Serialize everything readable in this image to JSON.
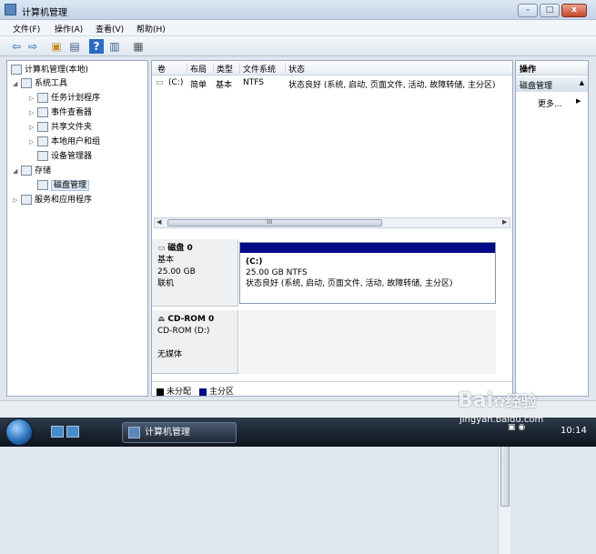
{
  "window": {
    "title": "计算机管理",
    "min_label": "–",
    "max_label": "□",
    "close_label": "x"
  },
  "menu": [
    "文件(F)",
    "操作(A)",
    "查看(V)",
    "帮助(H)"
  ],
  "toolbar": [
    {
      "icon": "back-arrow-icon",
      "glyph": "⇦"
    },
    {
      "icon": "forward-arrow-icon",
      "glyph": "⇨"
    },
    {
      "icon": "up-folder-icon",
      "glyph": "▣"
    },
    {
      "icon": "console-tree-icon",
      "glyph": "▤"
    },
    {
      "icon": "help-icon",
      "glyph": "?"
    },
    {
      "icon": "properties-icon",
      "glyph": "▥"
    },
    {
      "icon": "disk-view-icon",
      "glyph": "▦"
    }
  ],
  "tree": {
    "root": "计算机管理(本地)",
    "items": [
      {
        "label": "系统工具",
        "exp": "◢",
        "level": 1
      },
      {
        "label": "任务计划程序",
        "exp": "▷",
        "level": 2
      },
      {
        "label": "事件查看器",
        "exp": "▷",
        "level": 2
      },
      {
        "label": "共享文件夹",
        "exp": "▷",
        "level": 2
      },
      {
        "label": "本地用户和组",
        "exp": "▷",
        "level": 2
      },
      {
        "label": "设备管理器",
        "exp": "",
        "level": 2
      },
      {
        "label": "存储",
        "exp": "◢",
        "level": 1
      },
      {
        "label": "磁盘管理",
        "exp": "",
        "level": 2,
        "selected": true
      },
      {
        "label": "服务和应用程序",
        "exp": "▷",
        "level": 1
      }
    ]
  },
  "volumes": {
    "columns": [
      "卷",
      "布局",
      "类型",
      "文件系统",
      "状态"
    ],
    "rows": [
      {
        "vol": "(C:)",
        "layout": "简单",
        "type": "基本",
        "fs": "NTFS",
        "status": "状态良好 (系统, 启动, 页面文件, 活动, 故障转储, 主分区)"
      }
    ]
  },
  "scroll_grip": "III",
  "disks": [
    {
      "name": "磁盘 0",
      "kind": "基本",
      "size": "25.00 GB",
      "status": "联机",
      "partition": {
        "label": "(C:)",
        "size": "25.00 GB NTFS",
        "status": "状态良好 (系统, 启动, 页面文件, 活动, 故障转储, 主分区)"
      }
    },
    {
      "name": "CD-ROM 0",
      "kind": "CD-ROM (D:)",
      "status": "无媒体"
    }
  ],
  "legend": [
    {
      "label": "未分配",
      "color": "#000000"
    },
    {
      "label": "主分区",
      "color": "#000a84"
    }
  ],
  "actions": {
    "header": "操作",
    "section": "磁盘管理",
    "more": "更多..."
  },
  "taskbar": {
    "task": "计算机管理",
    "clock": "10:14"
  },
  "watermark": {
    "brand": "Bai",
    "brand2": "经验",
    "url": "jingyan.baidu.com"
  }
}
